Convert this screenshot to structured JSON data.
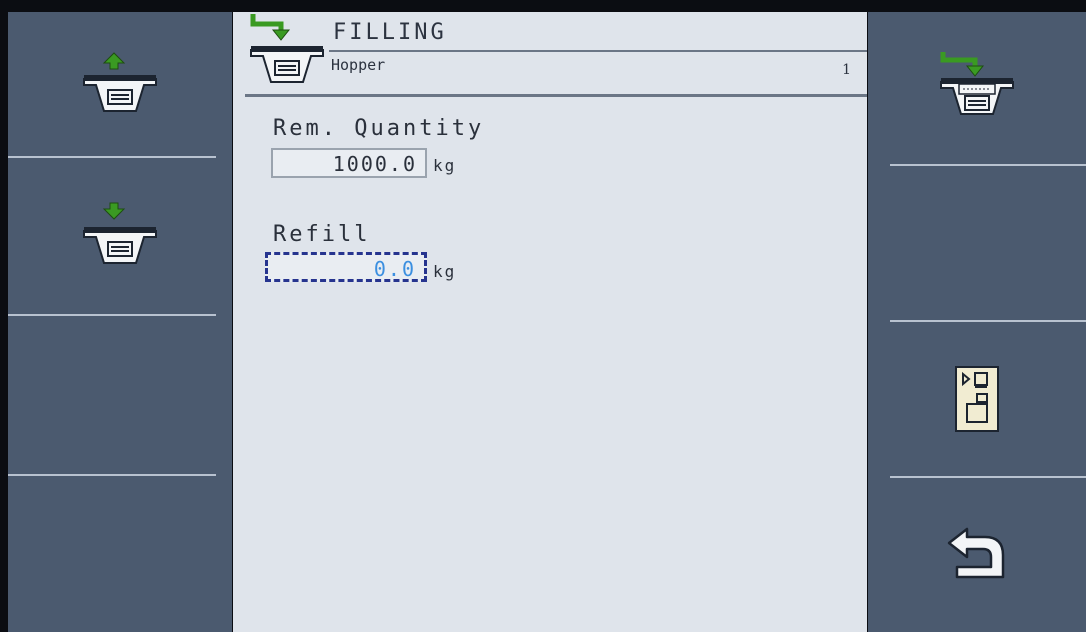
{
  "header": {
    "title": "FILLING",
    "subtitle": "Hopper",
    "page_number": "1"
  },
  "fields": {
    "rem_quantity": {
      "label": "Rem. Quantity",
      "value": "1000.0",
      "unit": "kg"
    },
    "refill": {
      "label": "Refill",
      "value": "0.0",
      "unit": "kg"
    }
  },
  "softkeys_left": [
    {
      "icon": "hopper-up-icon"
    },
    {
      "icon": "hopper-down-icon"
    }
  ],
  "softkeys_right": [
    {
      "icon": "hopper-fill-icon"
    },
    {
      "icon": "scale-calibration-icon"
    },
    {
      "icon": "back-arrow-icon"
    }
  ],
  "colors": {
    "panel": "#4b5a6f",
    "data_area": "#dfe4eb",
    "icon_green": "#3a8a1f",
    "edit_value": "#3b8fe0",
    "focus_border": "#26348f"
  }
}
